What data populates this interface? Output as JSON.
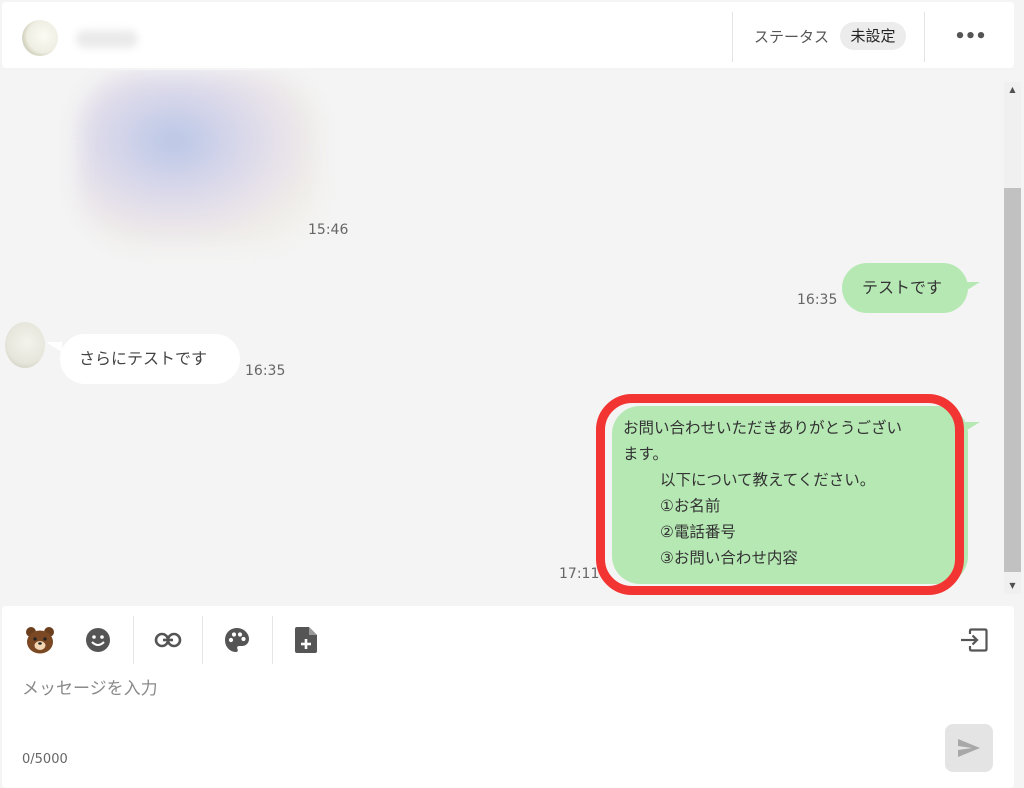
{
  "header": {
    "status_label": "ステータス",
    "status_value": "未設定",
    "more_icon": "more-horizontal-icon"
  },
  "messages": [
    {
      "direction": "incoming",
      "type": "image",
      "time": "15:46"
    },
    {
      "direction": "outgoing",
      "type": "text",
      "text": "テストです",
      "time": "16:35"
    },
    {
      "direction": "incoming",
      "type": "text",
      "text": "さらにテストです",
      "time": "16:35"
    },
    {
      "direction": "outgoing",
      "type": "text",
      "time": "17:11",
      "lines": [
        "お問い合わせいただきありがとうござい",
        "ます。",
        "以下について教えてください。",
        "①お名前",
        "②電話番号",
        "③お問い合わせ内容"
      ],
      "highlight_color": "#f23533"
    }
  ],
  "toolbar": {
    "icons": [
      "sticker-bear-icon",
      "emoji-icon",
      "link-icon",
      "palette-icon",
      "file-add-icon",
      "template-insert-icon"
    ]
  },
  "composer": {
    "placeholder": "メッセージを入力",
    "value": "",
    "counter": "0/5000",
    "send_icon": "send-icon"
  },
  "colors": {
    "outgoing_bubble": "#b6e8b4",
    "incoming_bubble": "#ffffff",
    "background": "#f4f4f4",
    "highlight": "#f23533"
  }
}
